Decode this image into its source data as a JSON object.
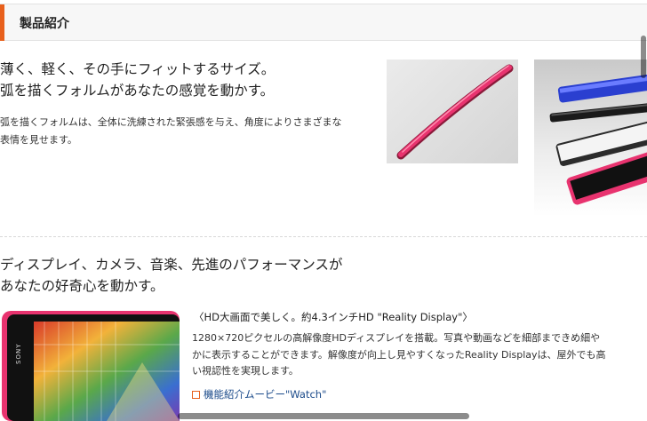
{
  "header": {
    "title": "製品紹介"
  },
  "intro": {
    "headline": "薄く、軽く、その手にフィットするサイズ。\n弧を描くフォルムがあなたの感覚を動かす。",
    "body": "弧を描くフォルムは、全体に洗練された緊張感を与え、角度によりさまざまな\n表情を見せます。"
  },
  "display_section": {
    "headline": "ディスプレイ、カメラ、音楽、先進のパフォーマンスが\nあなたの好奇心を動かす。",
    "feature_title": "〈HD大画面で美しく。約4.3インチHD \"Reality Display\"〉",
    "feature_desc": "1280×720ピクセルの高解像度HDディスプレイを搭載。写真や動画などを細部まできめ細や\nかに表示することができます。解像度が向上し見やすくなったReality Displayは、屋外でも高\nい視認性を実現します。",
    "link": "機能紹介ムービー\"Watch\""
  },
  "phone_brand": "SONY",
  "colors": {
    "accent": "#e8601c",
    "link": "#1a4a8a",
    "phone_pink": "#e8336f",
    "phone_blue": "#2a3fd0"
  }
}
